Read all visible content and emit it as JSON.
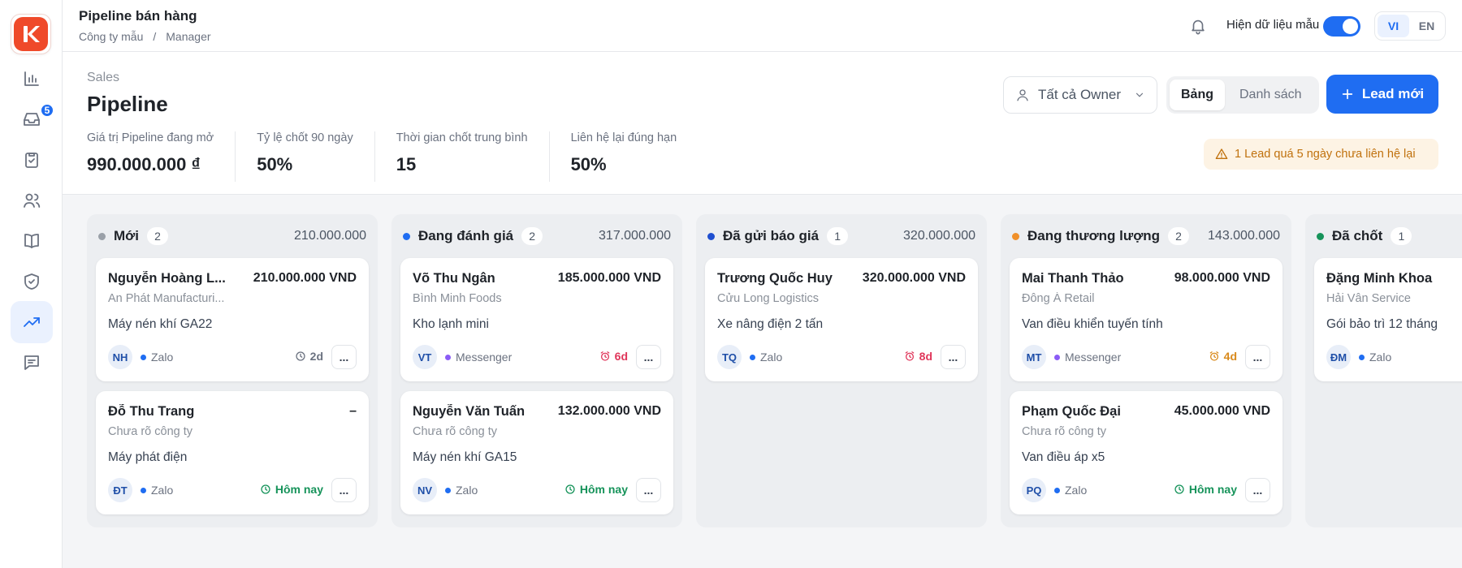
{
  "app": {
    "logo_letter": "K",
    "title": "Pipeline bán hàng",
    "breadcrumb": [
      "Công ty mẫu",
      "/",
      "Manager"
    ]
  },
  "sidebar": {
    "items": [
      {
        "icon": "chart-icon",
        "active": false
      },
      {
        "icon": "inbox-icon",
        "active": false,
        "badge": "5"
      },
      {
        "icon": "clipboard-check-icon",
        "active": false
      },
      {
        "icon": "users-icon",
        "active": false
      },
      {
        "icon": "book-icon",
        "active": false
      },
      {
        "icon": "shield-check-icon",
        "active": false
      },
      {
        "icon": "trending-up-icon",
        "active": true
      },
      {
        "icon": "message-icon",
        "active": false
      }
    ]
  },
  "topbar": {
    "sample_data_label": "Hiện dữ liệu mẫu",
    "sample_data_on": true,
    "lang_vi": "VI",
    "lang_en": "EN",
    "active_lang": "VI"
  },
  "header": {
    "eyebrow": "Sales",
    "title": "Pipeline",
    "owner_select": "Tất cả Owner",
    "view_board": "Bảng",
    "view_list": "Danh sách",
    "new_lead": "Lead mới",
    "stats": [
      {
        "label": "Giá trị Pipeline đang mở",
        "value": "990.000.000 ₫"
      },
      {
        "label": "Tỷ lệ chốt 90 ngày",
        "value": "50%"
      },
      {
        "label": "Thời gian chốt trung bình",
        "value": "15"
      },
      {
        "label": "Liên hệ lại đúng hạn",
        "value": "50%"
      }
    ],
    "alert": "1 Lead quá 5 ngày chưa liên hệ lại"
  },
  "colors": {
    "primary": "#1f6df2",
    "danger": "#e0365a",
    "warning": "#d98a1c",
    "success": "#16935a"
  },
  "columns": [
    {
      "name": "Mới",
      "count": "2",
      "sum": "210.000.000",
      "dot": "#9aa0a8",
      "cards": [
        {
          "name": "Nguyễn Hoàng L...",
          "value": "210.000.000 VND",
          "company": "An Phát Manufacturi...",
          "product": "Máy nén khí GA22",
          "initials": "NH",
          "channel": "Zalo",
          "channel_color": "#1f6df2",
          "time": "2d",
          "time_color": "#6b7280",
          "time_icon": "clock"
        },
        {
          "name": "Đỗ Thu Trang",
          "value": "–",
          "company": "Chưa rõ công ty",
          "product": "Máy phát điện",
          "initials": "ĐT",
          "channel": "Zalo",
          "channel_color": "#1f6df2",
          "time": "Hôm nay",
          "time_color": "#16935a",
          "time_icon": "clock"
        }
      ]
    },
    {
      "name": "Đang đánh giá",
      "count": "2",
      "sum": "317.000.000",
      "dot": "#1f6df2",
      "cards": [
        {
          "name": "Võ Thu Ngân",
          "value": "185.000.000 VND",
          "company": "Bình Minh Foods",
          "product": "Kho lạnh mini",
          "initials": "VT",
          "channel": "Messenger",
          "channel_color": "#8b5cf6",
          "time": "6d",
          "time_color": "#e0365a",
          "time_icon": "alarm"
        },
        {
          "name": "Nguyễn Văn Tuấn",
          "value": "132.000.000 VND",
          "company": "Chưa rõ công ty",
          "product": "Máy nén khí GA15",
          "initials": "NV",
          "channel": "Zalo",
          "channel_color": "#1f6df2",
          "time": "Hôm nay",
          "time_color": "#16935a",
          "time_icon": "clock"
        }
      ]
    },
    {
      "name": "Đã gửi báo giá",
      "count": "1",
      "sum": "320.000.000",
      "dot": "#1f4fd0",
      "cards": [
        {
          "name": "Trương Quốc Huy",
          "value": "320.000.000 VND",
          "company": "Cửu Long Logistics",
          "product": "Xe nâng điện 2 tấn",
          "initials": "TQ",
          "channel": "Zalo",
          "channel_color": "#1f6df2",
          "time": "8d",
          "time_color": "#e0365a",
          "time_icon": "alarm"
        }
      ]
    },
    {
      "name": "Đang thương lượng",
      "count": "2",
      "sum": "143.000.000",
      "dot": "#f0902a",
      "cards": [
        {
          "name": "Mai Thanh Thảo",
          "value": "98.000.000 VND",
          "company": "Đông Á Retail",
          "product": "Van điều khiển tuyến tính",
          "initials": "MT",
          "channel": "Messenger",
          "channel_color": "#8b5cf6",
          "time": "4d",
          "time_color": "#d98a1c",
          "time_icon": "alarm"
        },
        {
          "name": "Phạm Quốc Đại",
          "value": "45.000.000 VND",
          "company": "Chưa rõ công ty",
          "product": "Van điều áp x5",
          "initials": "PQ",
          "channel": "Zalo",
          "channel_color": "#1f6df2",
          "time": "Hôm nay",
          "time_color": "#16935a",
          "time_icon": "clock"
        }
      ]
    },
    {
      "name": "Đã chốt",
      "count": "1",
      "sum": "",
      "dot": "#16935a",
      "cards": [
        {
          "name": "Đặng Minh Khoa",
          "value": "",
          "company": "Hải Vân Service",
          "product": "Gói bảo trì 12 tháng",
          "initials": "ĐM",
          "channel": "Zalo",
          "channel_color": "#1f6df2",
          "time": "",
          "time_color": "#16935a",
          "time_icon": ""
        }
      ]
    }
  ]
}
